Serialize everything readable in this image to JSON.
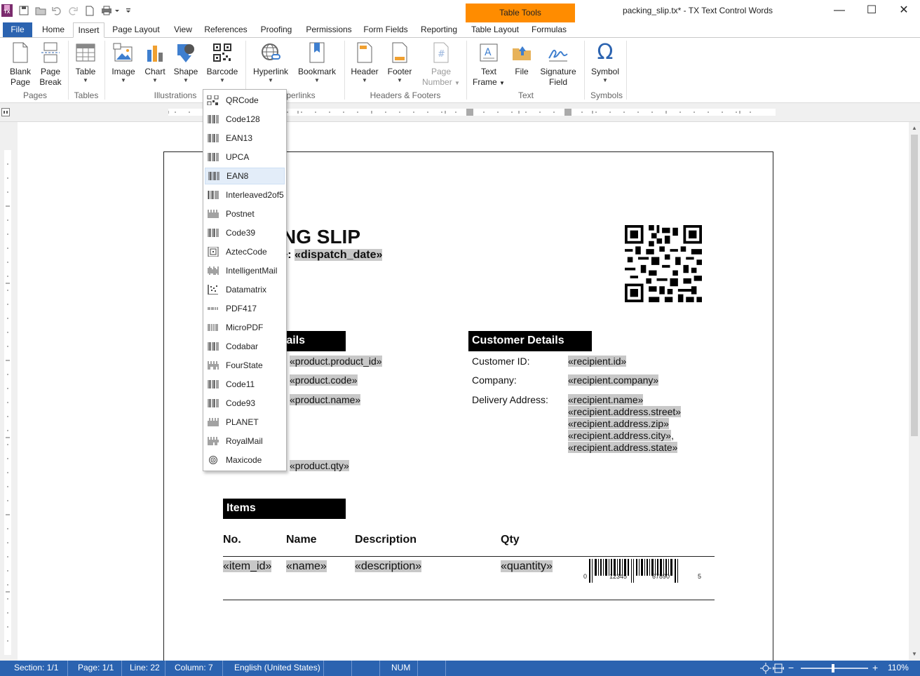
{
  "window": {
    "title": "packing_slip.tx* - TX Text Control Words",
    "context_tab_group": "Table Tools"
  },
  "tabs": [
    {
      "label": "File"
    },
    {
      "label": "Home"
    },
    {
      "label": "Insert"
    },
    {
      "label": "Page Layout"
    },
    {
      "label": "View"
    },
    {
      "label": "References"
    },
    {
      "label": "Proofing"
    },
    {
      "label": "Permissions"
    },
    {
      "label": "Form Fields"
    },
    {
      "label": "Reporting"
    },
    {
      "label": "Table Layout"
    },
    {
      "label": "Formulas"
    }
  ],
  "ribbon": {
    "buttons": [
      {
        "line1": "Blank",
        "line2": "Page"
      },
      {
        "line1": "Page",
        "line2": "Break"
      },
      {
        "line1": "Table",
        "line2": ""
      },
      {
        "line1": "Image",
        "line2": ""
      },
      {
        "line1": "Chart",
        "line2": ""
      },
      {
        "line1": "Shape",
        "line2": ""
      },
      {
        "line1": "Barcode",
        "line2": ""
      },
      {
        "line1": "Hyperlink",
        "line2": ""
      },
      {
        "line1": "Bookmark",
        "line2": ""
      },
      {
        "line1": "Header",
        "line2": ""
      },
      {
        "line1": "Footer",
        "line2": ""
      },
      {
        "line1": "Page",
        "line2": "Number"
      },
      {
        "line1": "Text",
        "line2": "Frame"
      },
      {
        "line1": "File",
        "line2": ""
      },
      {
        "line1": "Signature",
        "line2": "Field"
      },
      {
        "line1": "Symbol",
        "line2": ""
      }
    ],
    "groups": [
      {
        "label": "Pages"
      },
      {
        "label": "Tables"
      },
      {
        "label": "Illustrations"
      },
      {
        "label": "perlinks"
      },
      {
        "label": "Headers & Footers"
      },
      {
        "label": "Text"
      },
      {
        "label": "Symbols"
      }
    ]
  },
  "barcode_menu": {
    "items": [
      "QRCode",
      "Code128",
      "EAN13",
      "UPCA",
      "EAN8",
      "Interleaved2of5",
      "Postnet",
      "Code39",
      "AztecCode",
      "IntelligentMail",
      "Datamatrix",
      "PDF417",
      "MicroPDF",
      "Codabar",
      "FourState",
      "Code11",
      "Code93",
      "PLANET",
      "RoyalMail",
      "Maxicode"
    ],
    "highlighted": "EAN8"
  },
  "document": {
    "title_partial": "NG SLIP",
    "date_label_partial": "te:",
    "date_field": "«dispatch_date»",
    "product_header_partial": "tails",
    "customer_header": "Customer Details",
    "product_fields": [
      "«product.product_id»",
      "«product.code»",
      "«product.name»",
      "«product.qty»"
    ],
    "customer_labels": [
      "Customer ID:",
      "Company:",
      "Delivery Address:"
    ],
    "customer_fields": [
      "«recipient.id»",
      "«recipient.company»"
    ],
    "address_fields": [
      "«recipient.name»",
      "«recipient.address.street»",
      "«recipient.address.zip»",
      "«recipient.address.city»",
      "«recipient.address.state»"
    ],
    "address_separator": ",",
    "items_header": "Items",
    "columns": [
      "No.",
      "Name",
      "Description",
      "Qty"
    ],
    "row": [
      "«item_id»",
      "«name»",
      "«description»",
      "«quantity»"
    ],
    "barcode_digits": [
      "0",
      "12345",
      "67890",
      "5"
    ]
  },
  "status": {
    "section": "Section: 1/1",
    "page": "Page: 1/1",
    "line": "Line: 22",
    "column": "Column: 7",
    "language": "English (United States)",
    "num": "NUM",
    "zoom": "110%",
    "minus": "−",
    "plus": "+"
  }
}
